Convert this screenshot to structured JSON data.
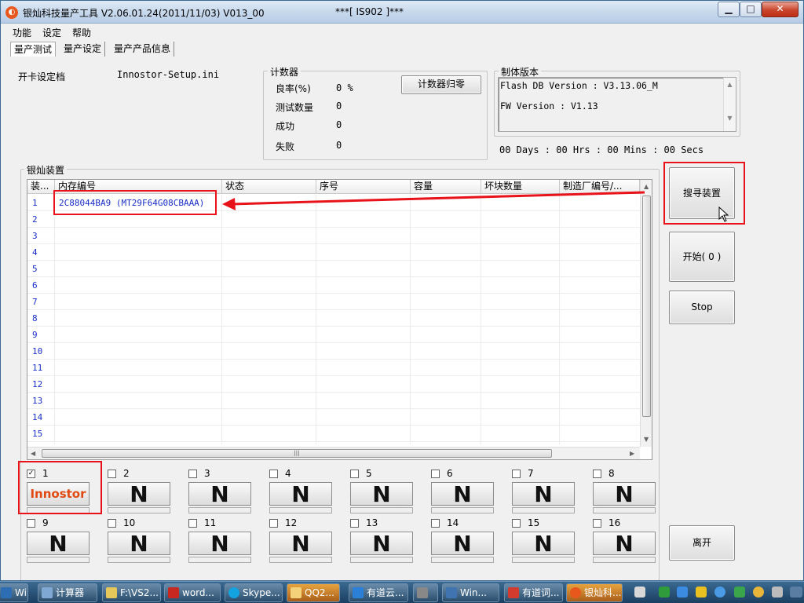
{
  "window": {
    "title": "银灿科技量产工具 V2.06.01.24(2011/11/03)    V013_00",
    "title_tag": "***[ IS902 ]***",
    "controls": {
      "minimize": "▁",
      "maximize": "□",
      "close": "✕"
    }
  },
  "menu": [
    "功能",
    "设定",
    "帮助"
  ],
  "tabs": [
    "量产测试",
    "量产设定",
    "量产产品信息"
  ],
  "setup": {
    "label": "开卡设定档",
    "value": "Innostor-Setup.ini"
  },
  "counter": {
    "title": "计数器",
    "reset_button": "计数器归零",
    "rows": [
      {
        "label": "良率(%)",
        "value": "0 %"
      },
      {
        "label": "测试数量",
        "value": "0"
      },
      {
        "label": "成功",
        "value": "0"
      },
      {
        "label": "失败",
        "value": "0"
      }
    ]
  },
  "firmware": {
    "title": "制体版本",
    "line1": "Flash DB Version :  V3.13.06_M",
    "line2": "FW Version :   V1.13"
  },
  "timer": "00 Days : 00 Hrs : 00 Mins : 00 Secs",
  "devices": {
    "title": "银灿装置",
    "columns": [
      "装...",
      "内存编号",
      "状态",
      "序号",
      "容量",
      "坏块数量",
      "制造厂编号/..."
    ],
    "rows": [
      {
        "no": "1",
        "memory": "2C88044BA9 (MT29F64G08CBAAA)"
      },
      {
        "no": "2",
        "memory": ""
      },
      {
        "no": "3",
        "memory": ""
      },
      {
        "no": "4",
        "memory": ""
      },
      {
        "no": "5",
        "memory": ""
      },
      {
        "no": "6",
        "memory": ""
      },
      {
        "no": "7",
        "memory": ""
      },
      {
        "no": "8",
        "memory": ""
      },
      {
        "no": "9",
        "memory": ""
      },
      {
        "no": "10",
        "memory": ""
      },
      {
        "no": "11",
        "memory": ""
      },
      {
        "no": "12",
        "memory": ""
      },
      {
        "no": "13",
        "memory": ""
      },
      {
        "no": "14",
        "memory": ""
      },
      {
        "no": "15",
        "memory": ""
      }
    ]
  },
  "buttons": {
    "search": "搜寻装置",
    "start": "开始( 0 )",
    "stop": "Stop",
    "exit": "离开"
  },
  "ports": [
    {
      "num": "1",
      "label": "Innostor",
      "checked": true
    },
    {
      "num": "2",
      "label": "N",
      "checked": false
    },
    {
      "num": "3",
      "label": "N",
      "checked": false
    },
    {
      "num": "4",
      "label": "N",
      "checked": false
    },
    {
      "num": "5",
      "label": "N",
      "checked": false
    },
    {
      "num": "6",
      "label": "N",
      "checked": false
    },
    {
      "num": "7",
      "label": "N",
      "checked": false
    },
    {
      "num": "8",
      "label": "N",
      "checked": false
    },
    {
      "num": "9",
      "label": "N",
      "checked": false
    },
    {
      "num": "10",
      "label": "N",
      "checked": false
    },
    {
      "num": "11",
      "label": "N",
      "checked": false
    },
    {
      "num": "12",
      "label": "N",
      "checked": false
    },
    {
      "num": "13",
      "label": "N",
      "checked": false
    },
    {
      "num": "14",
      "label": "N",
      "checked": false
    },
    {
      "num": "15",
      "label": "N",
      "checked": false
    },
    {
      "num": "16",
      "label": "N",
      "checked": false
    }
  ],
  "taskbar": {
    "items": [
      {
        "label": "Win...",
        "icon": "start-icon",
        "color": "#2d6db3"
      },
      {
        "label": "计算器",
        "icon": "calculator-icon",
        "color": "#7fa8d4"
      },
      {
        "label": "F:\\VS2...",
        "icon": "folder-icon",
        "color": "#e6c75a"
      },
      {
        "label": "word...",
        "icon": "filezilla-icon",
        "color": "#c8281f"
      },
      {
        "label": "Skype...",
        "icon": "skype-icon",
        "color": "#14a3e1"
      },
      {
        "label": "QQ2...",
        "icon": "qq-icon",
        "color": "#e8a33a"
      },
      {
        "label": "有道云...",
        "icon": "youdao-note-icon",
        "color": "#2b7fd6"
      },
      {
        "label": "",
        "icon": "clapper-icon",
        "color": "#888888"
      },
      {
        "label": "Win...",
        "icon": "python-icon",
        "color": "#3f74b0"
      },
      {
        "label": "有道词...",
        "icon": "youdao-dict-icon",
        "color": "#d33b2f"
      },
      {
        "label": "银灿科...",
        "icon": "app-icon",
        "color": "#e8571c"
      }
    ]
  },
  "colors": {
    "accent_red": "#e8131a",
    "innostor_orange": "#e04a12",
    "row_blue": "#1a2ec7"
  }
}
